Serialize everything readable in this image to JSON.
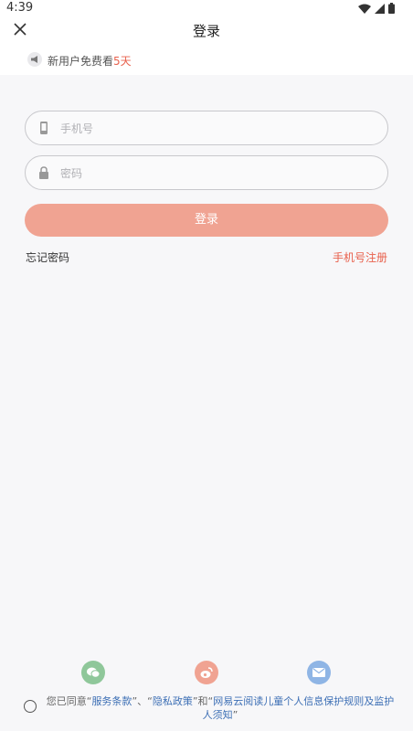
{
  "status_bar": {
    "time": "4:39"
  },
  "header": {
    "title": "登录"
  },
  "notice": {
    "text": "新用户免费看",
    "days": "5天"
  },
  "form": {
    "phone_placeholder": "手机号",
    "password_placeholder": "密码",
    "login_label": "登录",
    "forgot_label": "忘记密码",
    "register_label": "手机号注册"
  },
  "social": [
    {
      "name": "wechat",
      "color": "#8fc79a"
    },
    {
      "name": "weibo",
      "color": "#f0a392"
    },
    {
      "name": "email",
      "color": "#8fb5e5"
    }
  ],
  "agreement": {
    "prefix": "您已同意“",
    "terms": "服务条款",
    "sep1": "”、“",
    "privacy": "隐私政策",
    "sep2": "”和“",
    "children": "网易云阅读儿童个人信息保护规则及监护人须知",
    "suffix": "”"
  },
  "colors": {
    "accent": "#e8604c",
    "button": "#f0a392",
    "link": "#3d6fb5"
  }
}
